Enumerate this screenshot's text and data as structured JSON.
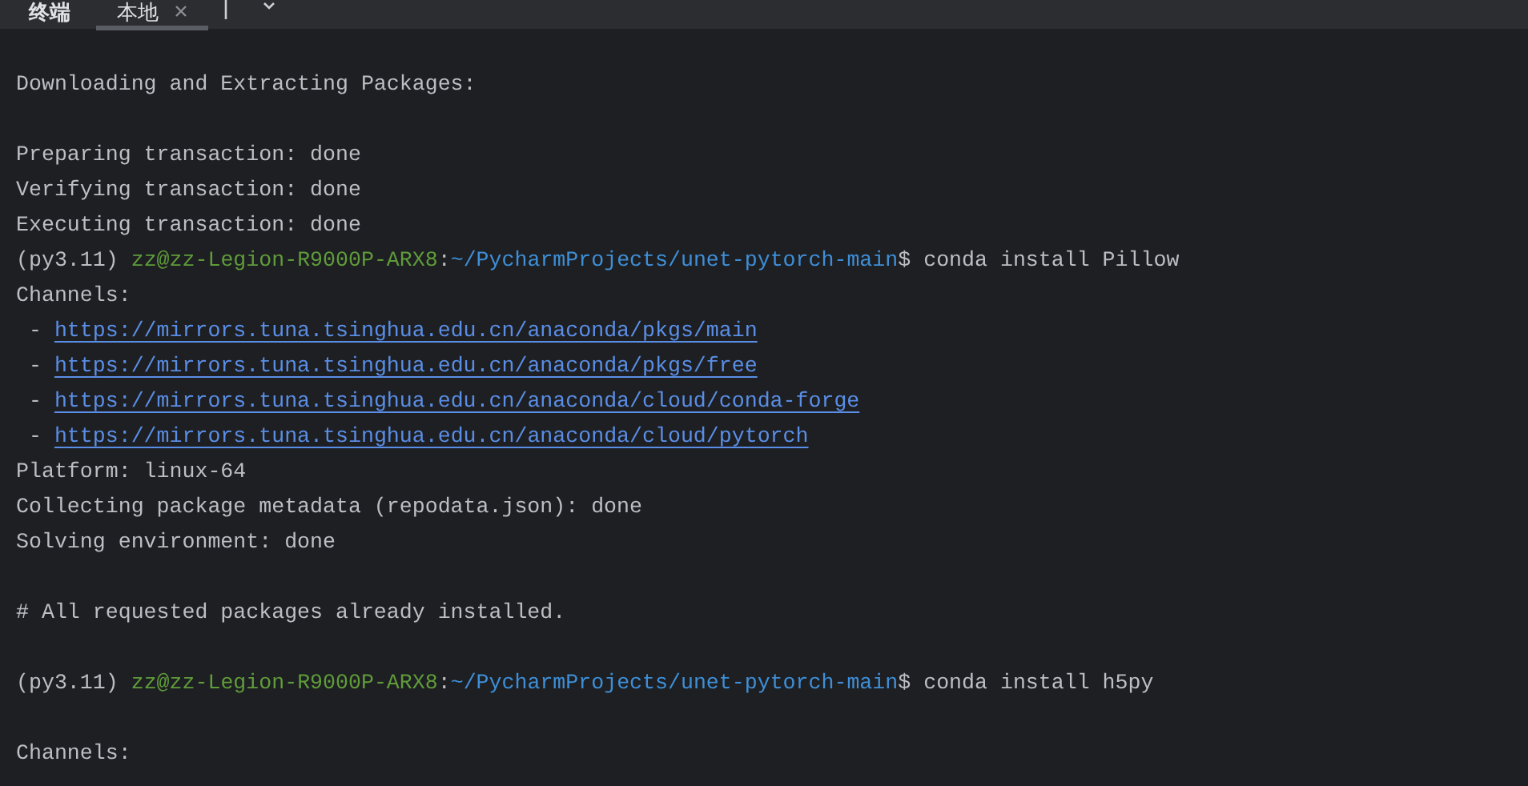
{
  "tabs": {
    "title": "终端",
    "items": [
      {
        "label": "本地",
        "selected": true,
        "closable": true
      }
    ]
  },
  "terminal": {
    "lines": [
      {
        "kind": "text",
        "text": "Downloading and Extracting Packages:"
      },
      {
        "kind": "blank"
      },
      {
        "kind": "text",
        "text": "Preparing transaction: done"
      },
      {
        "kind": "text",
        "text": "Verifying transaction: done"
      },
      {
        "kind": "text",
        "text": "Executing transaction: done"
      },
      {
        "kind": "prompt",
        "env": "(py3.11)",
        "user": "zz@zz-Legion-R9000P-ARX8",
        "separator": ":",
        "path": "~/PycharmProjects/unet-pytorch-main",
        "command": "$ conda install Pillow"
      },
      {
        "kind": "text",
        "text": "Channels:"
      },
      {
        "kind": "link",
        "bullet": " - ",
        "text": "https://mirrors.tuna.tsinghua.edu.cn/anaconda/pkgs/main"
      },
      {
        "kind": "link",
        "bullet": " - ",
        "text": "https://mirrors.tuna.tsinghua.edu.cn/anaconda/pkgs/free"
      },
      {
        "kind": "link",
        "bullet": " - ",
        "text": "https://mirrors.tuna.tsinghua.edu.cn/anaconda/cloud/conda-forge"
      },
      {
        "kind": "link",
        "bullet": " - ",
        "text": "https://mirrors.tuna.tsinghua.edu.cn/anaconda/cloud/pytorch"
      },
      {
        "kind": "text",
        "text": "Platform: linux-64"
      },
      {
        "kind": "text",
        "text": "Collecting package metadata (repodata.json): done"
      },
      {
        "kind": "text",
        "text": "Solving environment: done"
      },
      {
        "kind": "blank"
      },
      {
        "kind": "text",
        "text": "# All requested packages already installed."
      },
      {
        "kind": "blank"
      },
      {
        "kind": "prompt",
        "env": "(py3.11)",
        "user": "zz@zz-Legion-R9000P-ARX8",
        "separator": ":",
        "path": "~/PycharmProjects/unet-pytorch-main",
        "command": "$ conda install h5py"
      },
      {
        "kind": "blank"
      },
      {
        "kind": "text",
        "text": "Channels:"
      }
    ]
  }
}
